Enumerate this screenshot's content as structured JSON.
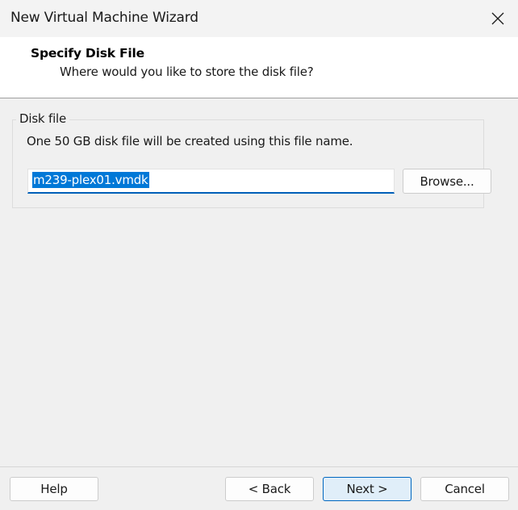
{
  "window": {
    "title": "New Virtual Machine Wizard"
  },
  "header": {
    "title": "Specify Disk File",
    "subtitle": "Where would you like to store the disk file?"
  },
  "disk_file": {
    "group_label": "Disk file",
    "description": "One 50 GB disk file will be created using this file name.",
    "file_name": "m239-plex01.vmdk",
    "browse_label": "Browse..."
  },
  "footer": {
    "help_label": "Help",
    "back_label": "< Back",
    "next_label": "Next >",
    "cancel_label": "Cancel"
  },
  "icons": {
    "close": "close-icon"
  },
  "colors": {
    "accent": "#0078d7",
    "default_button_border": "#0067c0",
    "default_button_bg": "#e0eef9"
  }
}
